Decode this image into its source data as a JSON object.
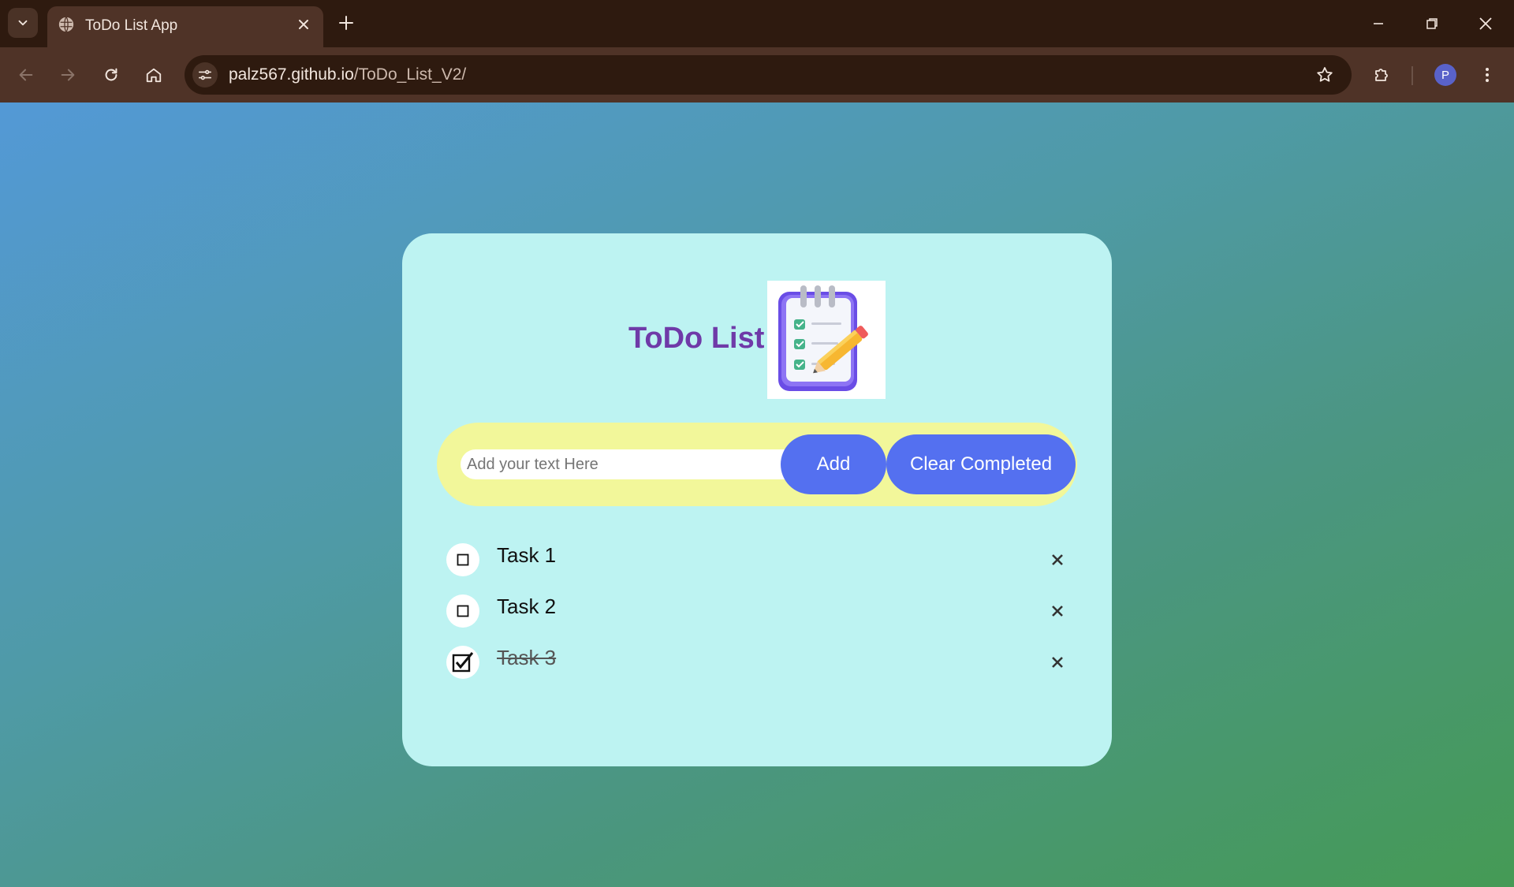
{
  "browser": {
    "tab_title": "ToDo List App",
    "url_host": "palz567.github.io",
    "url_path": "/ToDo_List_V2/",
    "profile_initial": "P"
  },
  "app": {
    "title": "ToDo List",
    "input_placeholder": "Add your text Here",
    "add_label": "Add",
    "clear_label": "Clear Completed",
    "tasks": [
      {
        "label": "Task 1",
        "completed": false
      },
      {
        "label": "Task 2",
        "completed": false
      },
      {
        "label": "Task 3",
        "completed": true
      }
    ]
  },
  "colors": {
    "accent_button": "#5470f0",
    "title": "#6f3aa8",
    "card": "#bdf3f2",
    "input_bar": "#f2f79a"
  }
}
